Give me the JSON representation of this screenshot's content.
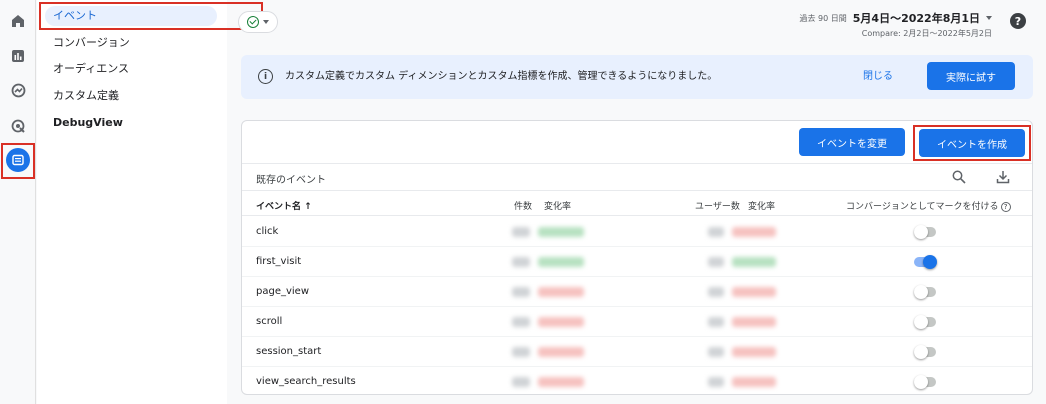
{
  "rail": {
    "icons": [
      "home-icon",
      "reports-icon",
      "explore-icon",
      "advertising-icon",
      "configure-icon"
    ]
  },
  "subnav": {
    "items": [
      {
        "label": "イベント",
        "selected": true
      },
      {
        "label": "コンバージョン"
      },
      {
        "label": "オーディエンス"
      },
      {
        "label": "カスタム定義"
      },
      {
        "label": "DebugView"
      }
    ]
  },
  "header": {
    "status_icon": "check-circle-icon",
    "date_prefix": "過去 90 日間",
    "date_range": "5月4日～2022年8月1日",
    "compare": "Compare: 2月2日～2022年5月2日",
    "help": "?"
  },
  "banner": {
    "info_glyph": "i",
    "message": "カスタム定義でカスタム ディメンションとカスタム指標を作成、管理できるようになりました。",
    "close_label": "閉じる",
    "try_label": "実際に試す"
  },
  "events_card": {
    "modify_label": "イベントを変更",
    "create_label": "イベントを作成",
    "section_title": "既存のイベント",
    "columns": {
      "name": "イベント名 ↑",
      "count": "件数",
      "count_change": "変化率",
      "users": "ユーザー数",
      "users_change": "変化率",
      "mark_conversion": "コンバージョンとしてマークを付ける"
    },
    "rows": [
      {
        "name": "click",
        "conversion": false,
        "count_trend": "up",
        "users_trend": "down"
      },
      {
        "name": "first_visit",
        "conversion": true,
        "count_trend": "up",
        "users_trend": "up"
      },
      {
        "name": "page_view",
        "conversion": false,
        "count_trend": "down",
        "users_trend": "down"
      },
      {
        "name": "scroll",
        "conversion": false,
        "count_trend": "down",
        "users_trend": "down"
      },
      {
        "name": "session_start",
        "conversion": false,
        "count_trend": "down",
        "users_trend": "down"
      },
      {
        "name": "view_search_results",
        "conversion": false,
        "count_trend": "down",
        "users_trend": "down"
      }
    ]
  },
  "colors": {
    "accent": "#1a73e8",
    "highlight_border": "#d93025",
    "trend_up": "#b7e1c1",
    "trend_down": "#f6c2c0"
  }
}
